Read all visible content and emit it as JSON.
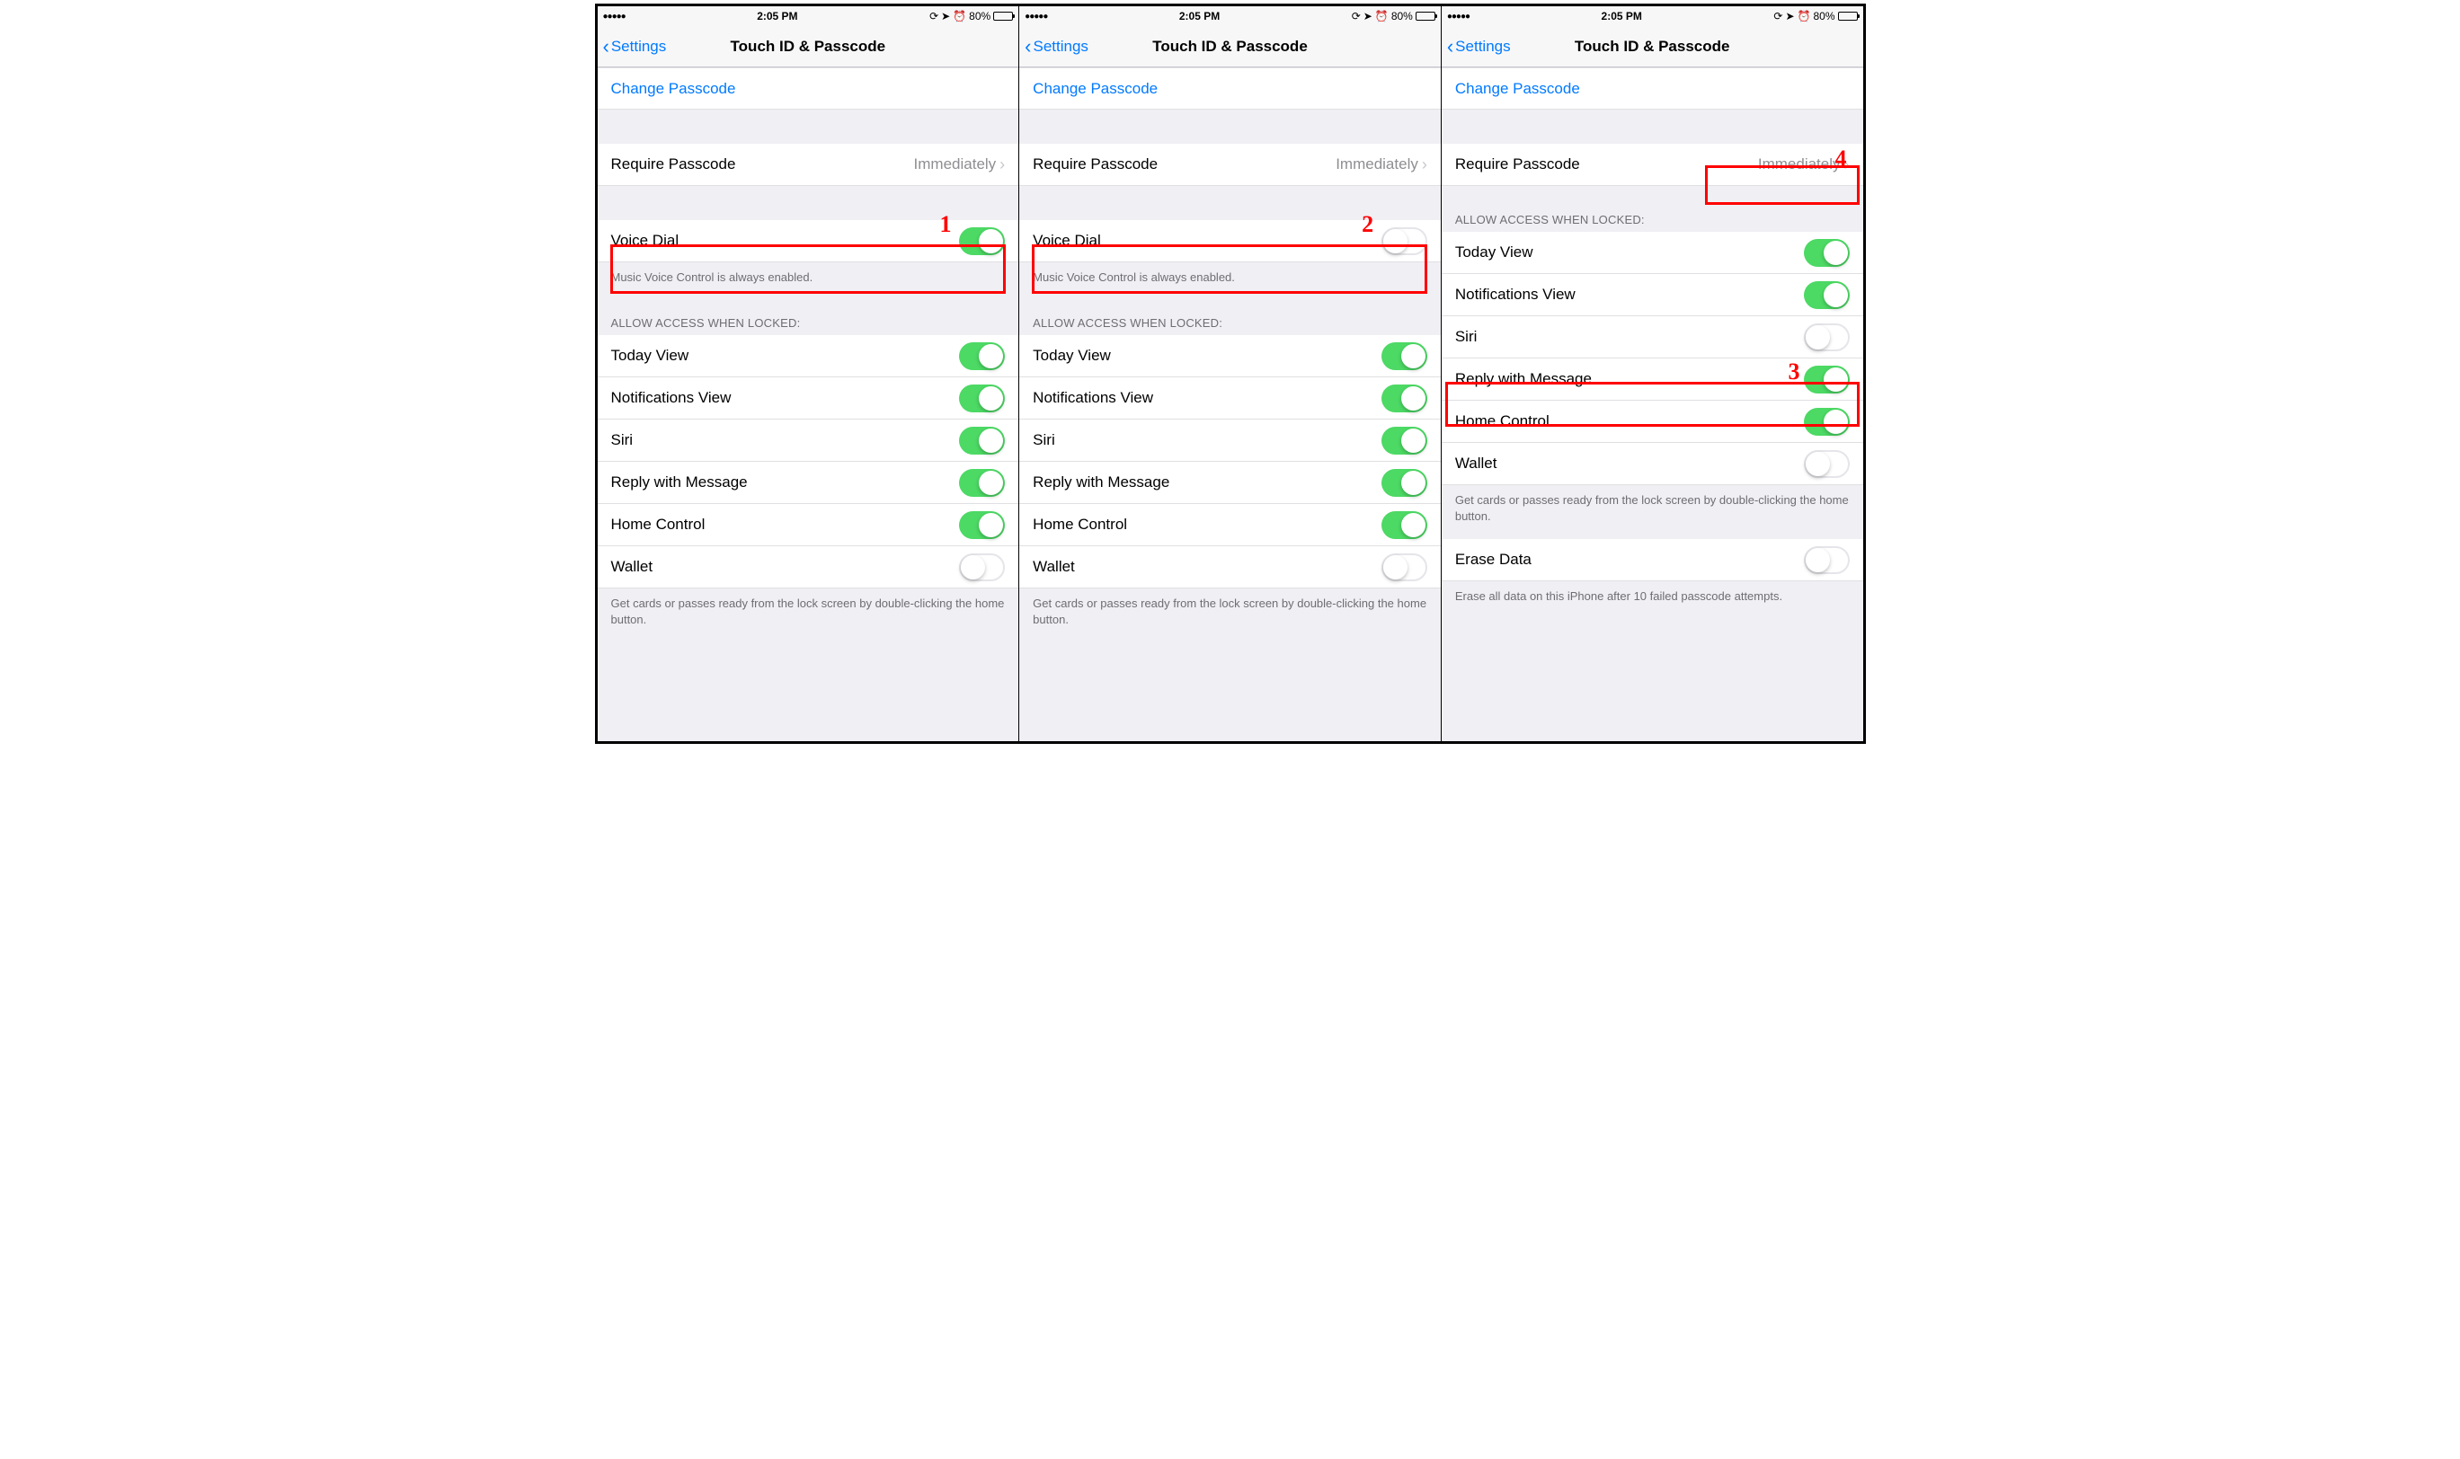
{
  "statusbar": {
    "time": "2:05 PM",
    "battery_pct": "80%",
    "signal_dots": "●●●●●"
  },
  "nav": {
    "back": "Settings",
    "title": "Touch ID & Passcode"
  },
  "labels": {
    "change_passcode": "Change Passcode",
    "require_passcode": "Require Passcode",
    "require_value": "Immediately",
    "voice_dial": "Voice Dial",
    "voice_dial_footer": "Music Voice Control is always enabled.",
    "allow_header": "ALLOW ACCESS WHEN LOCKED:",
    "today": "Today View",
    "notifications": "Notifications View",
    "siri": "Siri",
    "reply": "Reply with Message",
    "home_control": "Home Control",
    "wallet": "Wallet",
    "wallet_footer": "Get cards or passes ready from the lock screen by double-clicking the home button.",
    "erase": "Erase Data",
    "erase_footer": "Erase all data on this iPhone after 10 failed passcode attempts."
  },
  "screens": {
    "s1": {
      "show_voice_dial": true,
      "voice_dial_on": true,
      "siri_on": true,
      "wallet_on": false,
      "show_erase": false
    },
    "s2": {
      "show_voice_dial": true,
      "voice_dial_on": false,
      "siri_on": true,
      "wallet_on": false,
      "show_erase": false
    },
    "s3": {
      "show_voice_dial": false,
      "siri_on": false,
      "wallet_on": false,
      "show_erase": true,
      "erase_on": false
    }
  },
  "annotations": {
    "a1": "1",
    "a2": "2",
    "a3": "3",
    "a4": "4"
  }
}
